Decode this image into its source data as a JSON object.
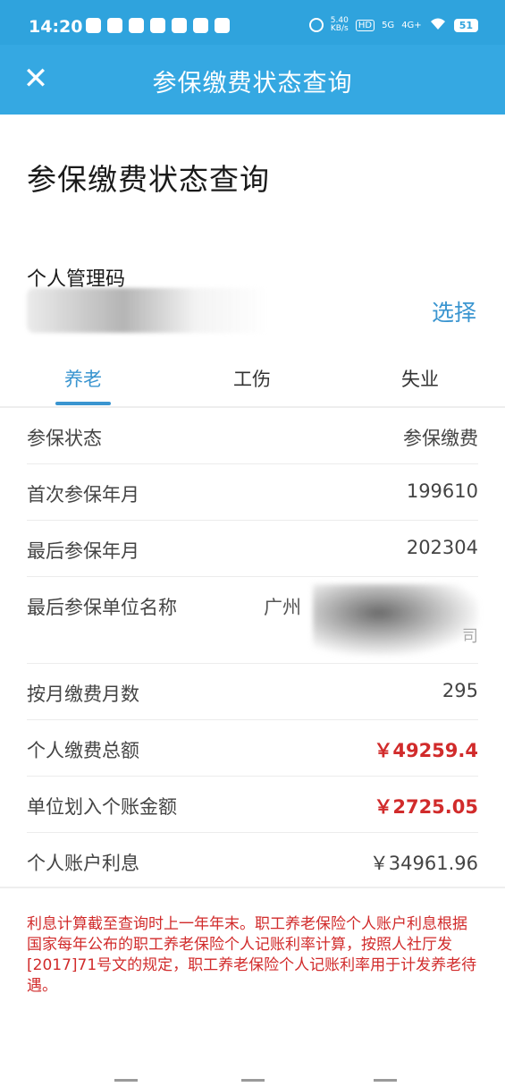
{
  "status": {
    "time": "14:20",
    "net_speed_value": "5.40",
    "net_speed_unit": "KB/s",
    "hd": "HD",
    "signal_5g": "5G",
    "signal_4g": "4G+",
    "battery": "51"
  },
  "appbar": {
    "close": "✕",
    "title": "参保缴费状态查询"
  },
  "page": {
    "title": "参保缴费状态查询",
    "code_label": "个人管理码",
    "choose": "选择"
  },
  "tabs": [
    "养老",
    "工伤",
    "失业"
  ],
  "rows": {
    "status": {
      "label": "参保状态",
      "value": "参保缴费"
    },
    "first": {
      "label": "首次参保年月",
      "value": "199610"
    },
    "last": {
      "label": "最后参保年月",
      "value": "202304"
    },
    "company": {
      "label": "最后参保单位名称",
      "prefix": "广州",
      "tail": "司"
    },
    "months": {
      "label": "按月缴费月数",
      "value": "295"
    },
    "personal_total": {
      "label": "个人缴费总额",
      "value": "￥49259.4"
    },
    "unit_transfer": {
      "label": "单位划入个账金额",
      "value": "￥2725.05"
    },
    "interest": {
      "label": "个人账户利息",
      "value": "￥34961.96"
    }
  },
  "note": "利息计算截至查询时上一年年末。职工养老保险个人账户利息根据国家每年公布的职工养老保险个人记账利率计算，按照人社厅发[2017]71号文的规定，职工养老保险个人记账利率用于计发养老待遇。",
  "colors": {
    "statusbar": "#2fa3dd",
    "appbar": "#35a8e2",
    "accent": "#3a95d0",
    "money_red": "#d12b2b"
  }
}
